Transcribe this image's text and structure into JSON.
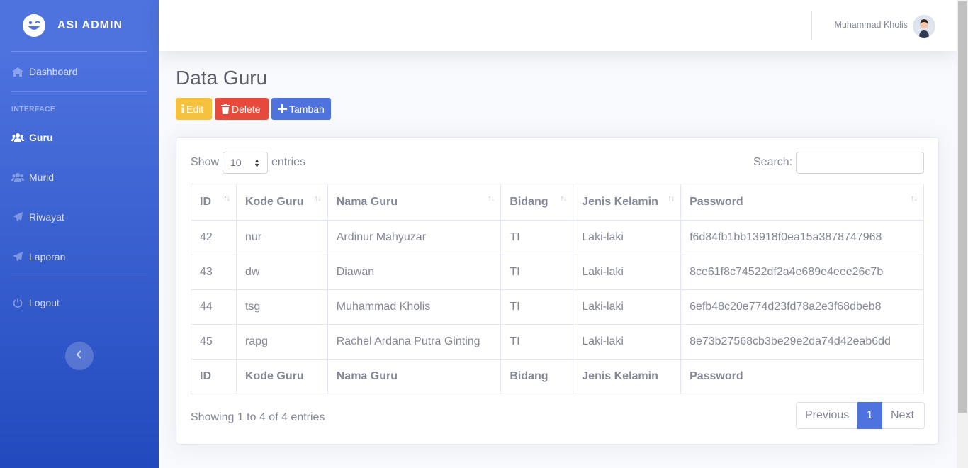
{
  "brand": {
    "title": "ASI ADMIN",
    "icon": "laughing-wink-icon"
  },
  "sidebar": {
    "items": [
      {
        "label": "Dashboard",
        "icon": "home-icon"
      },
      {
        "label": "Guru",
        "icon": "users-icon"
      },
      {
        "label": "Murid",
        "icon": "users-icon"
      },
      {
        "label": "Riwayat",
        "icon": "paper-plane-icon"
      },
      {
        "label": "Laporan",
        "icon": "paper-plane-icon"
      },
      {
        "label": "Logout",
        "icon": "power-icon"
      }
    ],
    "heading": "INTERFACE",
    "active": "Guru"
  },
  "topbar": {
    "user_name": "Muhammad Kholis"
  },
  "page": {
    "title": "Data Guru",
    "buttons": {
      "edit": "Edit",
      "delete": "Delete",
      "add": "Tambah"
    }
  },
  "table_controls": {
    "show": "Show",
    "page_size": "10",
    "entries": "entries",
    "search": "Search:"
  },
  "table": {
    "columns": [
      "ID",
      "Kode Guru",
      "Nama Guru",
      "Bidang",
      "Jenis Kelamin",
      "Password"
    ],
    "rows": [
      [
        "42",
        "nur",
        "Ardinur Mahyuzar",
        "TI",
        "Laki-laki",
        "f6d84fb1bb13918f0ea15a3878747968"
      ],
      [
        "43",
        "dw",
        "Diawan",
        "TI",
        "Laki-laki",
        "8ce61f8c74522df2a4e689e4eee26c7b"
      ],
      [
        "44",
        "tsg",
        "Muhammad Kholis",
        "TI",
        "Laki-laki",
        "6efb48c20e774d23fd78a2e3f68dbeb8"
      ],
      [
        "45",
        "rapg",
        "Rachel Ardana Putra Ginting",
        "TI",
        "Laki-laki",
        "8e73b27568cb3be29e2da74d42eab6dd"
      ]
    ]
  },
  "footer": {
    "info": "Showing 1 to 4 of 4 entries",
    "previous": "Previous",
    "current_page": "1",
    "next": "Next"
  },
  "colors": {
    "primary": "#4e73df",
    "warning": "#f6c23e",
    "danger": "#e74a3b"
  }
}
